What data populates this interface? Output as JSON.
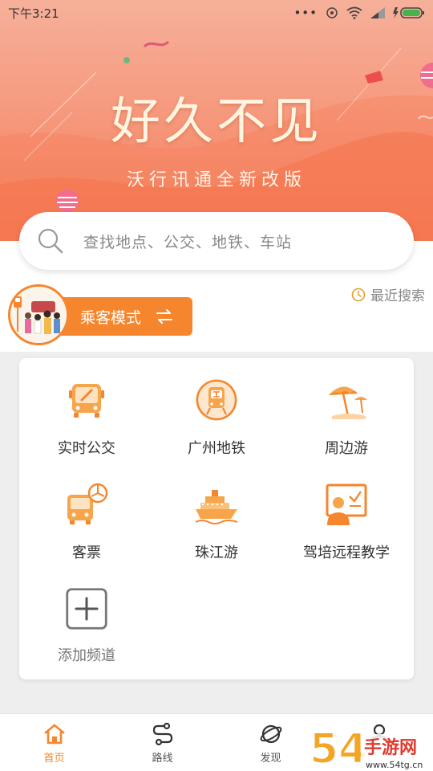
{
  "status_bar": {
    "time": "下午3:21",
    "dots": "•••"
  },
  "banner": {
    "title": "好久不见",
    "subtitle": "沃行讯通全新改版"
  },
  "search": {
    "placeholder": "查找地点、公交、地铁、车站"
  },
  "mode": {
    "label": "乘客模式"
  },
  "recent_search": {
    "label": "最近搜索"
  },
  "channels": [
    {
      "label": "实时公交",
      "icon": "bus-icon"
    },
    {
      "label": "广州地铁",
      "icon": "metro-icon"
    },
    {
      "label": "周边游",
      "icon": "beach-umbrella-icon"
    },
    {
      "label": "客票",
      "icon": "coach-ticket-icon"
    },
    {
      "label": "珠江游",
      "icon": "cruise-ship-icon"
    },
    {
      "label": "驾培远程教学",
      "icon": "teaching-board-icon"
    },
    {
      "label": "添加频道",
      "icon": "add-icon"
    }
  ],
  "bottom_nav": [
    {
      "label": "首页",
      "icon": "home-icon",
      "active": true
    },
    {
      "label": "路线",
      "icon": "route-icon",
      "active": false
    },
    {
      "label": "发现",
      "icon": "planet-icon",
      "active": false
    },
    {
      "label": "",
      "icon": "profile-icon",
      "active": false
    }
  ],
  "watermark": {
    "brand": "54",
    "text": "手游网",
    "url": "www.54tg.cn"
  },
  "colors": {
    "accent": "#f5862e",
    "banner_top": "#f6b09a",
    "banner_bottom": "#f47b56"
  }
}
